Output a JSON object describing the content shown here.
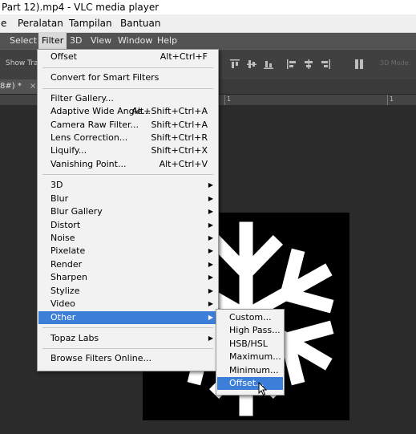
{
  "vlc": {
    "title": "Part 12).mp4 - VLC media player",
    "menu": [
      "e",
      "Peralatan",
      "Tampilan",
      "Bantuan"
    ]
  },
  "photoshop": {
    "menubar": [
      "Select",
      "Filter",
      "3D",
      "View",
      "Window",
      "Help"
    ],
    "active_menu": "Filter",
    "options": {
      "show_transform": "Show Tran",
      "mode_3d": "3D Mode:"
    },
    "doc_tab": {
      "title": "8#) *",
      "close": "×"
    },
    "ruler": [
      "1",
      "1"
    ]
  },
  "filter_menu": {
    "items": [
      {
        "label": "Offset",
        "shortcut": "Alt+Ctrl+F"
      },
      {
        "label": "Convert for Smart Filters",
        "shortcut": ""
      },
      {
        "label": "Filter Gallery...",
        "shortcut": ""
      },
      {
        "label": "Adaptive Wide Angle...",
        "shortcut": "Alt+Shift+Ctrl+A"
      },
      {
        "label": "Camera Raw Filter...",
        "shortcut": "Shift+Ctrl+A"
      },
      {
        "label": "Lens Correction...",
        "shortcut": "Shift+Ctrl+R"
      },
      {
        "label": "Liquify...",
        "shortcut": "Shift+Ctrl+X"
      },
      {
        "label": "Vanishing Point...",
        "shortcut": "Alt+Ctrl+V"
      },
      {
        "label": "3D",
        "submenu": true
      },
      {
        "label": "Blur",
        "submenu": true
      },
      {
        "label": "Blur Gallery",
        "submenu": true
      },
      {
        "label": "Distort",
        "submenu": true
      },
      {
        "label": "Noise",
        "submenu": true
      },
      {
        "label": "Pixelate",
        "submenu": true
      },
      {
        "label": "Render",
        "submenu": true
      },
      {
        "label": "Sharpen",
        "submenu": true
      },
      {
        "label": "Stylize",
        "submenu": true
      },
      {
        "label": "Video",
        "submenu": true
      },
      {
        "label": "Other",
        "submenu": true,
        "highlighted": true
      },
      {
        "label": "Topaz Labs",
        "submenu": true
      },
      {
        "label": "Browse Filters Online...",
        "shortcut": ""
      }
    ],
    "submenu_arrow": "▶"
  },
  "other_submenu": {
    "items": [
      {
        "label": "Custom..."
      },
      {
        "label": "High Pass..."
      },
      {
        "label": "HSB/HSL"
      },
      {
        "label": "Maximum..."
      },
      {
        "label": "Minimum..."
      },
      {
        "label": "Offset...",
        "highlighted": true
      }
    ]
  },
  "colors": {
    "highlight": "#3d7fd8",
    "menu_bg": "#f2f2f2",
    "ps_dark": "#2b2b2b"
  }
}
